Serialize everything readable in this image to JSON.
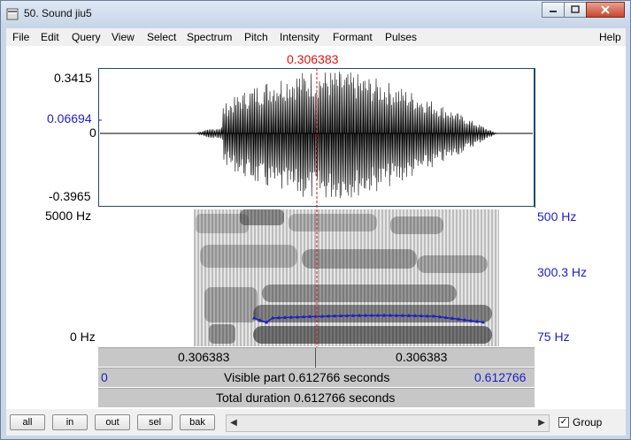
{
  "window": {
    "title": "50. Sound jiu5"
  },
  "menu": [
    "File",
    "Edit",
    "Query",
    "View",
    "Select",
    "Spectrum",
    "Pitch",
    "Intensity",
    "Formant",
    "Pulses",
    "Help"
  ],
  "cursor": {
    "time": "0.306383"
  },
  "waveform": {
    "ymax": "0.3415",
    "ycursor": "0.06694",
    "yzero": "0",
    "ymin": "-0.3965"
  },
  "spectrogram": {
    "ftop": "5000 Hz",
    "fbottom": "0 Hz"
  },
  "pitch": {
    "top": "500 Hz",
    "mid": "300.3 Hz",
    "bottom": "75 Hz"
  },
  "time_bar": {
    "left_value": "0.306383",
    "right_value": "0.306383",
    "visible_start": "0",
    "visible_label": "Visible part 0.612766 seconds",
    "visible_end": "0.612766",
    "total_label": "Total duration 0.612766 seconds"
  },
  "buttons": {
    "all": "all",
    "in": "in",
    "out": "out",
    "sel": "sel",
    "bak": "bak"
  },
  "group": {
    "label": "Group",
    "checked": true
  }
}
